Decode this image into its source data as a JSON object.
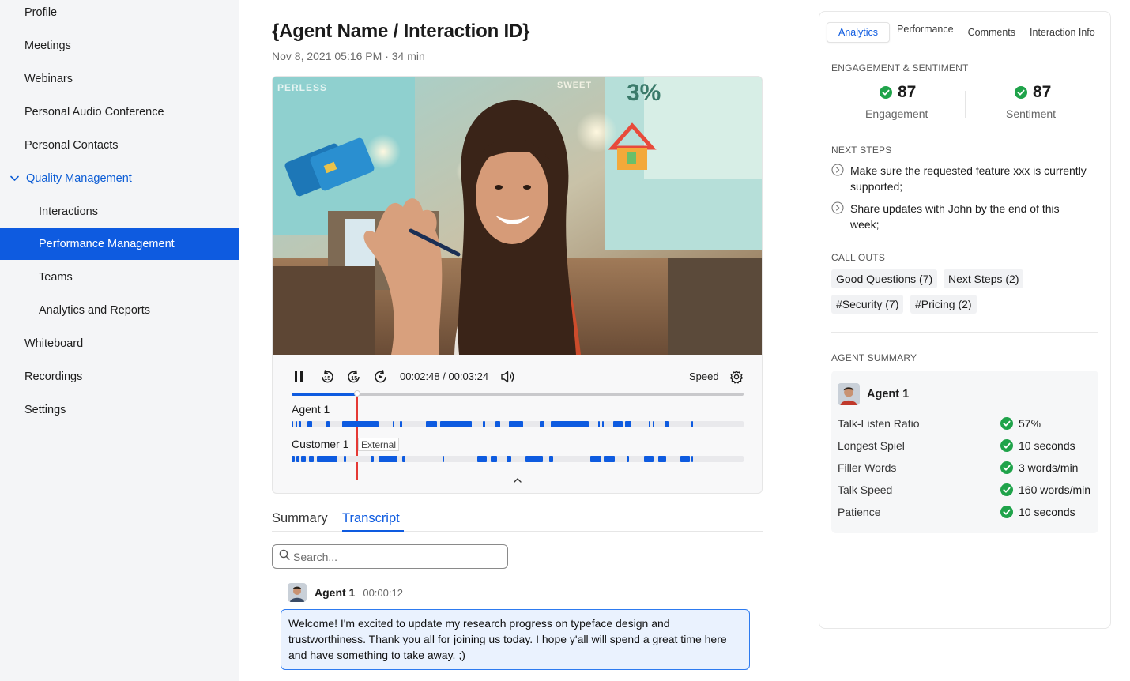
{
  "sidebar": {
    "items": [
      {
        "label": "Profile"
      },
      {
        "label": "Meetings"
      },
      {
        "label": "Webinars"
      },
      {
        "label": "Personal Audio Conference"
      },
      {
        "label": "Personal Contacts"
      },
      {
        "label": "Quality Management"
      },
      {
        "label": "Interactions"
      },
      {
        "label": "Performance Management"
      },
      {
        "label": "Teams"
      },
      {
        "label": "Analytics and Reports"
      },
      {
        "label": "Whiteboard"
      },
      {
        "label": "Recordings"
      },
      {
        "label": "Settings"
      }
    ],
    "expanded_group": "Quality Management",
    "active_item": "Performance Management"
  },
  "header": {
    "title": "{Agent Name / Interaction ID}",
    "meta": "Nov 8, 2021 05:16 PM · 34 min"
  },
  "player": {
    "time": "00:02:48 / 00:03:24",
    "speed_label": "Speed",
    "progress": 0.143,
    "tracks": [
      {
        "label": "Agent 1",
        "badge": ""
      },
      {
        "label": "Customer 1",
        "badge": "External"
      }
    ],
    "icons": [
      "pause-icon",
      "rewind-15-icon",
      "forward-15-icon",
      "replay-icon",
      "volume-icon",
      "settings-gear-icon",
      "chevron-up-icon"
    ]
  },
  "content_tabs": {
    "summary": "Summary",
    "transcript": "Transcript",
    "active": "Transcript"
  },
  "search": {
    "placeholder": "Search..."
  },
  "transcript": {
    "messages": [
      {
        "speaker": "Agent 1",
        "time": "00:00:12",
        "text": "Welcome! I'm excited to update my research progress on typeface design and trustworthiness. Thank you all for joining us today. I hope y'all will spend a great time here and have something to take away. ;)"
      }
    ]
  },
  "panel": {
    "tabs": [
      {
        "label": "Analytics"
      },
      {
        "label": "Performance"
      },
      {
        "label": "Comments"
      },
      {
        "label": "Interaction Info"
      }
    ],
    "active_tab": "Analytics",
    "engagement_section": {
      "title": "ENGAGEMENT & SENTIMENT",
      "engagement_value": "87",
      "engagement_label": "Engagement",
      "sentiment_value": "87",
      "sentiment_label": "Sentiment"
    },
    "next_steps": {
      "title": "NEXT STEPS",
      "items": [
        "Make sure the requested feature xxx is currently supported;",
        "Share updates with John by the end of this week;"
      ]
    },
    "call_outs": {
      "title": "CALL OUTS",
      "chips": [
        "Good Questions (7)",
        "Next Steps (2)",
        "#Security (7)",
        "#Pricing (2)"
      ]
    },
    "agent_summary": {
      "title": "AGENT SUMMARY",
      "agent": "Agent 1",
      "metrics": [
        {
          "label": "Talk-Listen Ratio",
          "value": "57%"
        },
        {
          "label": "Longest Spiel",
          "value": "10 seconds"
        },
        {
          "label": "Filler Words",
          "value": "3 words/min"
        },
        {
          "label": "Talk Speed",
          "value": "160 words/min"
        },
        {
          "label": "Patience",
          "value": "10 seconds"
        }
      ]
    }
  },
  "colors": {
    "accent": "#0e5be0",
    "success": "#1fa34a",
    "playhead": "#e53935"
  }
}
